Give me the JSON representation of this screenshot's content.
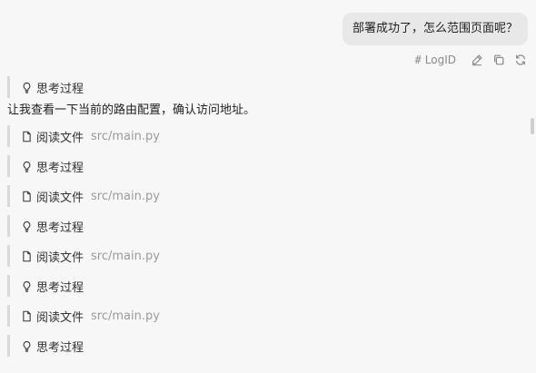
{
  "user_message": "部署成功了，怎么范围页面呢？",
  "actions": {
    "logid_label": "LogID",
    "icons": [
      "hash-icon",
      "edit-icon",
      "copy-icon",
      "retry-icon"
    ]
  },
  "steps": [
    {
      "kind": "thinking",
      "label": "思考过程"
    },
    {
      "kind": "text",
      "label": "让我查看一下当前的路由配置，确认访问地址。"
    },
    {
      "kind": "read",
      "label": "阅读文件",
      "path": "src/main.py"
    },
    {
      "kind": "thinking",
      "label": "思考过程"
    },
    {
      "kind": "read",
      "label": "阅读文件",
      "path": "src/main.py"
    },
    {
      "kind": "thinking",
      "label": "思考过程"
    },
    {
      "kind": "read",
      "label": "阅读文件",
      "path": "src/main.py"
    },
    {
      "kind": "thinking",
      "label": "思考过程"
    },
    {
      "kind": "read",
      "label": "阅读文件",
      "path": "src/main.py"
    },
    {
      "kind": "thinking",
      "label": "思考过程"
    }
  ]
}
